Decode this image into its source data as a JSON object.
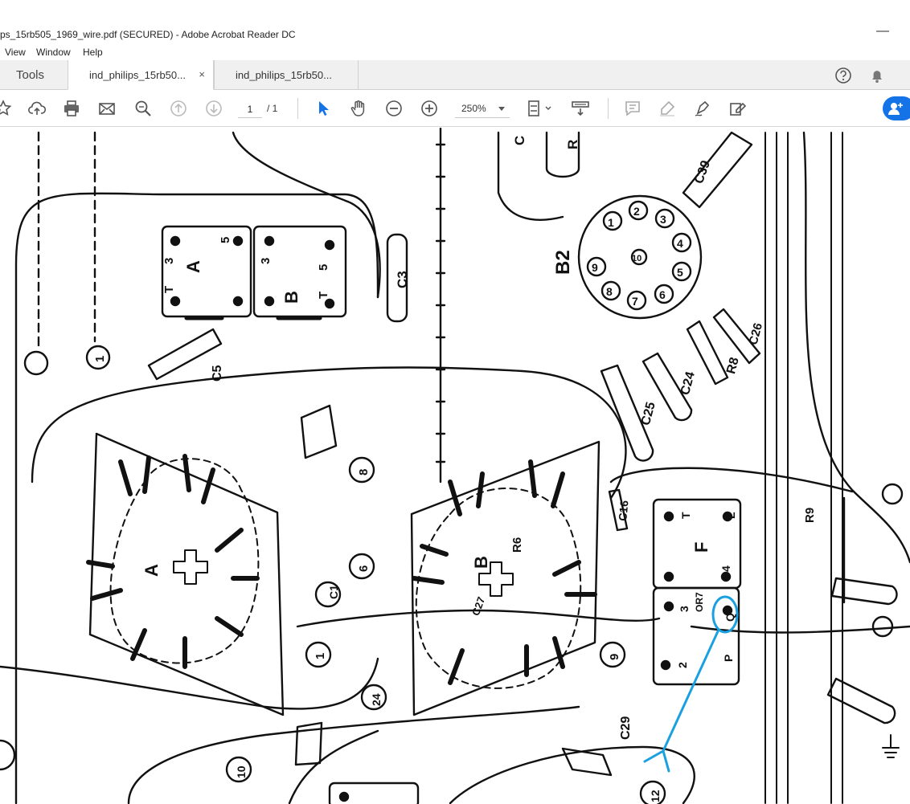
{
  "window": {
    "title": "ps_15rb505_1969_wire.pdf (SECURED) - Adobe Acrobat Reader DC",
    "minimize_glyph": "—"
  },
  "menu": [
    "View",
    "Window",
    "Help"
  ],
  "tabs": {
    "tools_label": "Tools",
    "doc_tabs": [
      {
        "label": "ind_philips_15rb50...",
        "active": true
      },
      {
        "label": "ind_philips_15rb50...",
        "active": false
      }
    ],
    "close_glyph": "×"
  },
  "toolbar": {
    "page_current": "1",
    "page_total": "/ 1",
    "zoom": "250%",
    "icons": [
      "star-icon",
      "upload-icon",
      "print-icon",
      "mail-icon",
      "search-zoom-icon",
      "page-up-icon",
      "page-down-icon",
      "select-arrow-icon",
      "hand-icon",
      "zoom-out-icon",
      "zoom-in-icon",
      "fit-page-icon",
      "scroll-mode-icon",
      "comment-icon",
      "highlight-icon",
      "sign-icon",
      "edit-icon"
    ]
  },
  "colors": {
    "accent": "#1473e6",
    "annotation": "#1aa0e0",
    "tab_bg": "#f0f0f0",
    "ink": "#111111"
  },
  "schematic": {
    "labels": {
      "A": "A",
      "B": "B",
      "B2": "B2",
      "F": "F",
      "C3": "C3",
      "C5": "C5",
      "C1": "C1",
      "C16": "C16",
      "C24": "C24",
      "C25": "C25",
      "C26": "C26",
      "C27": "C27",
      "C29": "C29",
      "C39": "C39",
      "R6": "R6",
      "R8": "R8",
      "R9": "R9",
      "R": "R",
      "C": "C",
      "T": "T",
      "L": "L",
      "P": "P",
      "1": "1",
      "2": "2",
      "3": "3",
      "4": "4",
      "5": "5",
      "6": "6",
      "7": "7",
      "8": "8",
      "9": "9",
      "10": "10",
      "12": "12",
      "24": "24",
      "Q": "Q",
      "OR7": "OR7"
    }
  }
}
